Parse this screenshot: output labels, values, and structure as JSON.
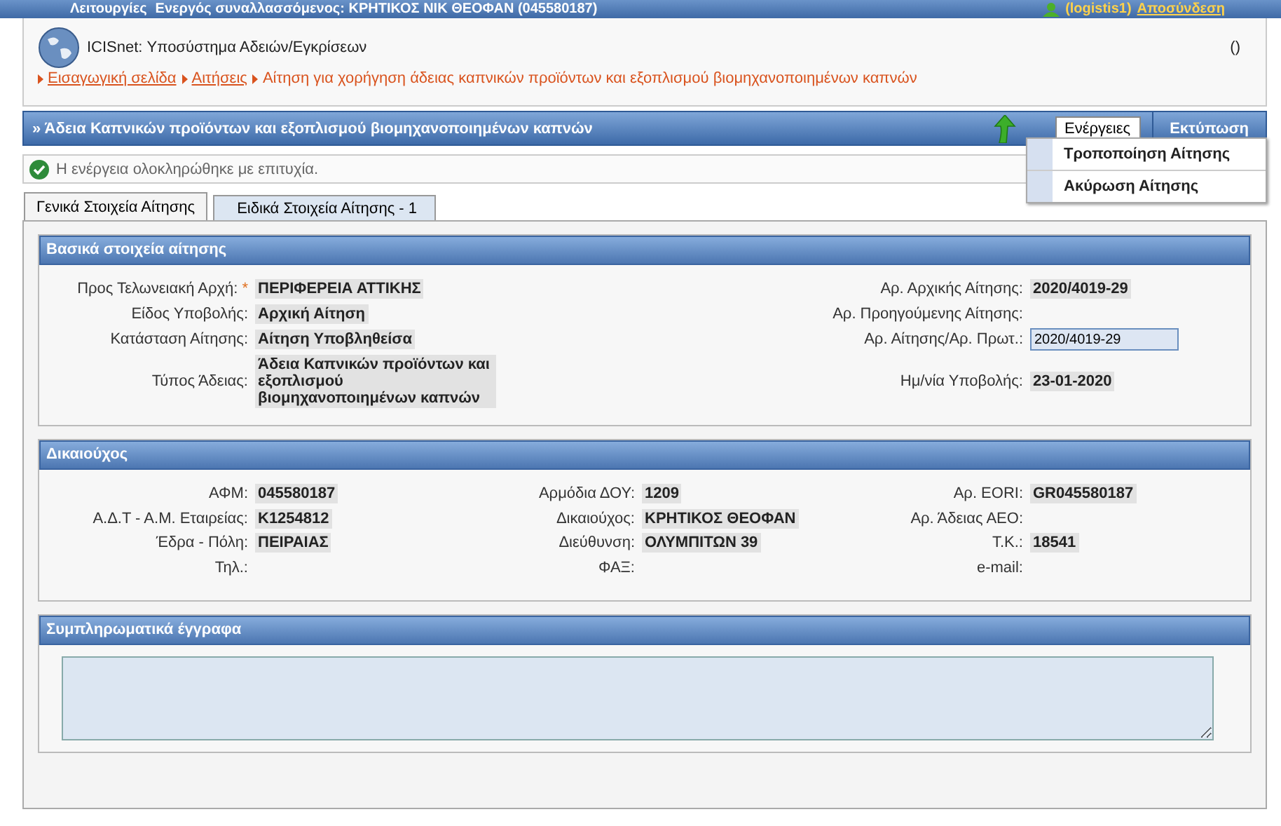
{
  "top_bar": {
    "menu": "Λειτουργίες",
    "user_info": "Ενεργός συναλλασσόμενος: ΚΡΗΤΙΚΟΣ ΝΙΚ ΘΕΟΦΑΝ (045580187)",
    "user": "(logistis1)",
    "logout": "Αποσύνδεση"
  },
  "header": {
    "app_title": "ICISnet: Υποσύστημα Αδειών/Εγκρίσεων",
    "right_text": "()",
    "breadcrumb": [
      {
        "label": "Εισαγωγική σελίδα",
        "link": true
      },
      {
        "label": "Αιτήσεις",
        "link": true
      },
      {
        "label": "Αίτηση για χορήγηση άδειας καπνικών προϊόντων και εξοπλισμού βιομηχανοποιημένων καπνών",
        "link": false
      }
    ]
  },
  "title_bar": {
    "title": "» Άδεια Καπνικών προϊόντων και εξοπλισμού βιομηχανοποιημένων καπνών",
    "buttons": [
      {
        "label": "Ενέργειες",
        "selected": true
      },
      {
        "label": "Εκτύπωση",
        "selected": false
      }
    ]
  },
  "actions_menu": [
    "Τροποποίηση Αίτησης",
    "Ακύρωση Αίτησης"
  ],
  "message": "Η ενέργεια ολοκληρώθηκε με επιτυχία.",
  "tabs": [
    {
      "label": "Γενικά Στοιχεία Αίτησης",
      "selected": true
    },
    {
      "label": "Ειδικά Στοιχεία Αίτησης - 1",
      "selected": false
    }
  ],
  "basic_section": {
    "title": "Βασικά στοιχεία αίτησης",
    "rows": [
      [
        {
          "label": "Προς Τελωνειακή Αρχή:",
          "required_mark": "*",
          "kind": "text",
          "value": "ΠΕΡΙΦΕΡΕΙΑ ΑΤΤΙΚΗΣ"
        },
        {
          "label": "Αρ. Αρχικής Αίτησης:",
          "kind": "text",
          "value": "2020/4019-29"
        }
      ],
      [
        {
          "label": "Είδος Υποβολής:",
          "kind": "text",
          "value": "Αρχική Αίτηση"
        },
        {
          "label": "Αρ. Προηγούμενης Αίτησης:"
        }
      ],
      [
        {
          "label": "Κατάσταση Αίτησης:",
          "kind": "text",
          "value": "Αίτηση Υποβληθείσα"
        },
        {
          "label": "Αρ. Αίτησης/Αρ. Πρωτ.:",
          "kind": "input",
          "value": "2020/4019-29"
        }
      ],
      [
        {
          "label": "Τύπος Άδειας:",
          "kind": "text",
          "value": "Άδεια Καπνικών προϊόντων και εξοπλισμού βιομηχανοποιημένων καπνών"
        },
        {
          "label": "Ημ/νία Υποβολής:",
          "kind": "text",
          "value": "23-01-2020"
        }
      ]
    ]
  },
  "beneficiary_section": {
    "title": "Δικαιούχος",
    "rows": [
      [
        {
          "label": "ΑΦΜ:",
          "value": "045580187"
        },
        {
          "label": "Αρμόδια ΔΟΥ:",
          "value": "1209"
        },
        {
          "label": "Αρ. EORI:",
          "value": "GR045580187"
        }
      ],
      [
        {
          "label": "Α.Δ.Τ - Α.Μ. Εταιρείας:",
          "value": "Κ1254812"
        },
        {
          "label": "Δικαιούχος:",
          "value": "ΚΡΗΤΙΚΟΣ ΘΕΟΦΑΝ"
        },
        {
          "label": "Αρ. Άδειας ΑΕΟ:"
        }
      ],
      [
        {
          "label": "Έδρα - Πόλη:",
          "value": "ΠΕΙΡΑΙΑΣ"
        },
        {
          "label": "Διεύθυνση:",
          "value": "ΟΛΥΜΠΙΤΩΝ 39"
        },
        {
          "label": "Τ.Κ.:",
          "value": "18541"
        }
      ],
      [
        {
          "label": "Τηλ.:"
        },
        {
          "label": "ΦΑΞ:"
        },
        {
          "label": "e-mail:"
        }
      ]
    ]
  },
  "documents_section": {
    "title": "Συμπληρωματικά έγγραφα"
  }
}
